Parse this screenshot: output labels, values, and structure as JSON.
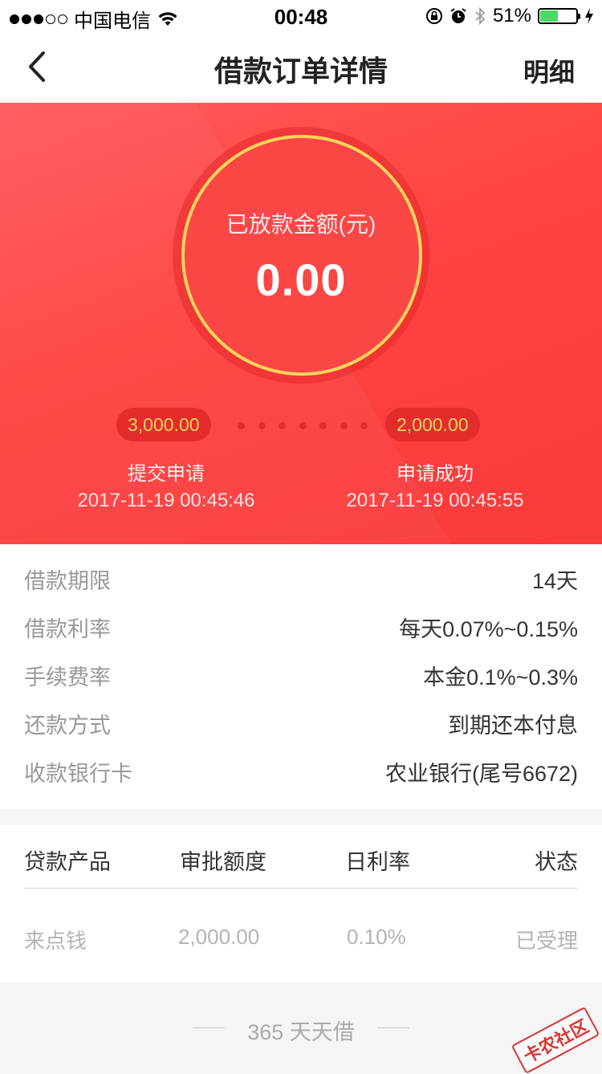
{
  "status_bar": {
    "carrier": "中国电信",
    "time": "00:48",
    "battery": "51%",
    "battery_level": 0.51
  },
  "nav": {
    "title": "借款订单详情",
    "detail_link": "明细",
    "back_icon": "chevron-left-icon"
  },
  "hero": {
    "amount_label": "已放款金额(元)",
    "amount": "0.00",
    "steps": [
      {
        "amount": "3,000.00",
        "label": "提交申请",
        "time": "2017-11-19 00:45:46"
      },
      {
        "amount": "2,000.00",
        "label": "申请成功",
        "time": "2017-11-19 00:45:55"
      }
    ],
    "colors": {
      "accent": "#ff4242",
      "ring": "#f8d45c",
      "pill": "#e52c2c"
    }
  },
  "info": [
    {
      "key": "借款期限",
      "value": "14天"
    },
    {
      "key": "借款利率",
      "value": "每天0.07%~0.15%"
    },
    {
      "key": "手续费率",
      "value": "本金0.1%~0.3%"
    },
    {
      "key": "还款方式",
      "value": "到期还本付息"
    },
    {
      "key": "收款银行卡",
      "value": "农业银行(尾号6672)"
    }
  ],
  "table": {
    "headers": [
      "贷款产品",
      "审批额度",
      "日利率",
      "状态"
    ],
    "rows": [
      [
        "来点钱",
        "2,000.00",
        "0.10%",
        "已受理"
      ]
    ]
  },
  "footer": {
    "text": "365 天天借"
  },
  "watermark": "卡农社区"
}
